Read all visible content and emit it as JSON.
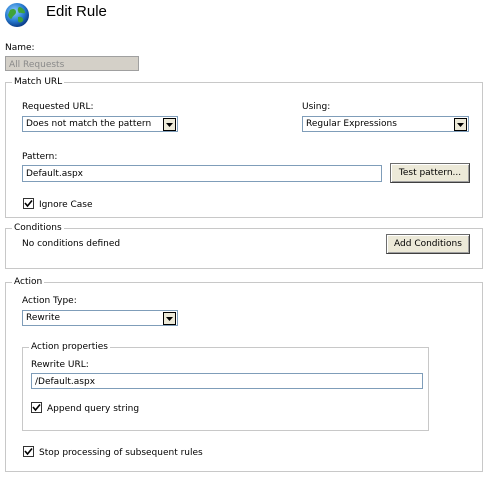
{
  "header": {
    "title": "Edit Rule",
    "icon": "globe-icon"
  },
  "name_field": {
    "label": "Name:",
    "value": "All Requests"
  },
  "match_url": {
    "group_label": "Match URL",
    "requested_url_label": "Requested URL:",
    "requested_url_value": "Does not match the pattern",
    "using_label": "Using:",
    "using_value": "Regular Expressions",
    "pattern_label": "Pattern:",
    "pattern_value": "Default.aspx",
    "test_pattern_button": "Test pattern...",
    "ignore_case_label": "Ignore Case",
    "ignore_case_checked": true
  },
  "conditions": {
    "group_label": "Conditions",
    "status_text": "No conditions defined",
    "add_button": "Add Conditions"
  },
  "action": {
    "group_label": "Action",
    "action_type_label": "Action Type:",
    "action_type_value": "Rewrite",
    "properties_group_label": "Action properties",
    "rewrite_url_label": "Rewrite URL:",
    "rewrite_url_value": "/Default.aspx",
    "append_query_label": "Append query string",
    "append_query_checked": true,
    "stop_processing_label": "Stop processing of subsequent rules",
    "stop_processing_checked": true
  }
}
